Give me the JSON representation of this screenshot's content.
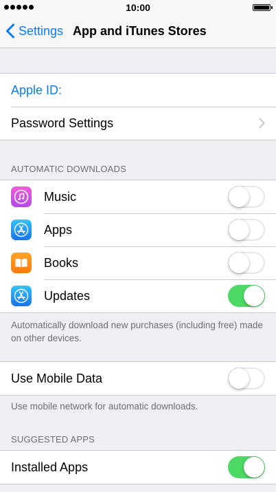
{
  "status_bar": {
    "time": "10:00"
  },
  "nav": {
    "back_label": "Settings",
    "title": "App and iTunes Stores"
  },
  "account": {
    "apple_id_label": "Apple ID:",
    "password_settings_label": "Password Settings"
  },
  "automatic_downloads": {
    "header": "AUTOMATIC DOWNLOADS",
    "items": [
      {
        "label": "Music",
        "icon": "itunes-music-icon",
        "enabled": false
      },
      {
        "label": "Apps",
        "icon": "app-store-icon",
        "enabled": false
      },
      {
        "label": "Books",
        "icon": "ibooks-icon",
        "enabled": false
      },
      {
        "label": "Updates",
        "icon": "app-store-icon",
        "enabled": true
      }
    ],
    "footer": "Automatically download new purchases (including free) made on other devices."
  },
  "mobile_data": {
    "label": "Use Mobile Data",
    "enabled": false,
    "footer": "Use mobile network for automatic downloads."
  },
  "suggested_apps": {
    "header": "SUGGESTED APPS",
    "installed_apps_label": "Installed Apps",
    "installed_apps_enabled": true
  },
  "colors": {
    "accent": "#0a7bff",
    "toggle_on": "#4cd964",
    "background": "#efeff4",
    "separator": "#c8c7cc"
  }
}
